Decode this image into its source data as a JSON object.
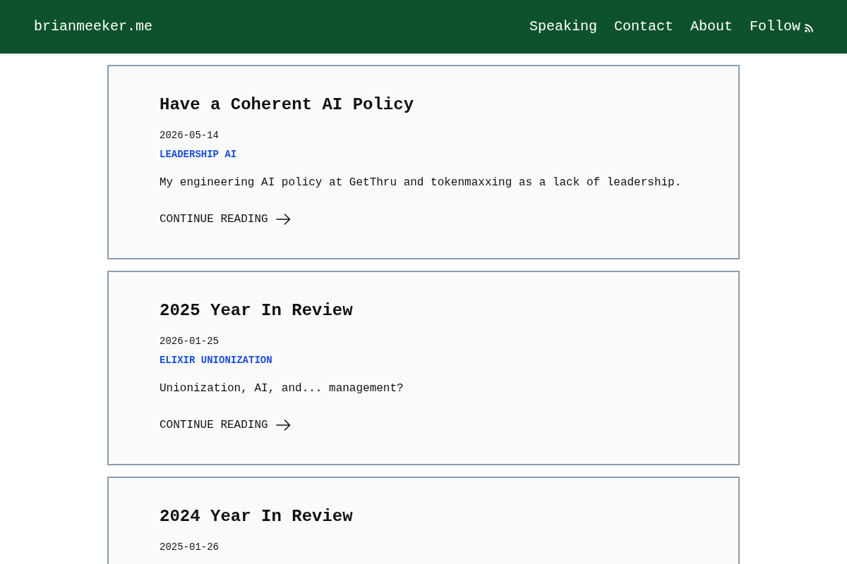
{
  "header": {
    "site_title": "brianmeeker.me",
    "nav": [
      {
        "label": "Speaking",
        "kind": "link"
      },
      {
        "label": "Contact",
        "kind": "link"
      },
      {
        "label": "About",
        "kind": "link"
      },
      {
        "label": "Follow",
        "kind": "feed"
      }
    ]
  },
  "posts": [
    {
      "title": "Have a Coherent AI Policy",
      "date": "2026-05-14",
      "tags": [
        "LEADERSHIP",
        "AI"
      ],
      "summary": "My engineering AI policy at GetThru and tokenmaxxing as a lack of leadership.",
      "link_label": "CONTINUE READING"
    },
    {
      "title": "2025 Year In Review",
      "date": "2026-01-25",
      "tags": [
        "ELIXIR",
        "UNIONIZATION"
      ],
      "summary": "Unionization, AI, and... management?",
      "link_label": "CONTINUE READING"
    },
    {
      "title": "2024 Year In Review",
      "date": "2025-01-26"
    }
  ]
}
